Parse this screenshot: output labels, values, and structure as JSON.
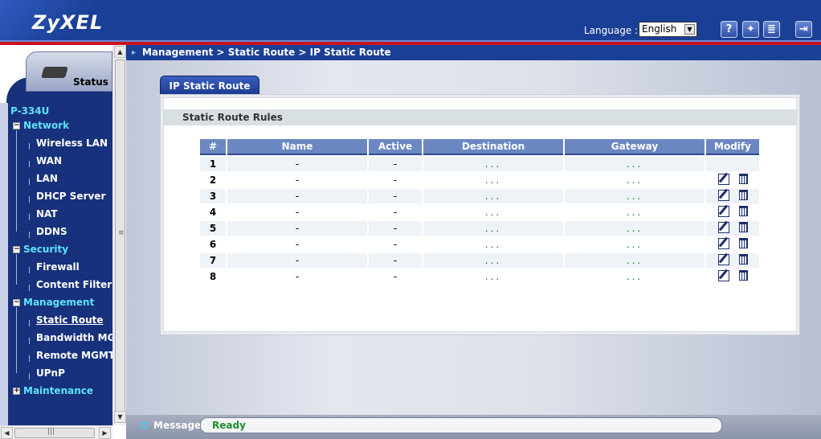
{
  "header": {
    "logo": "ZyXEL",
    "language_label": "Language :",
    "language_value": "English",
    "buttons": [
      {
        "name": "help-icon",
        "glyph": "?"
      },
      {
        "name": "wizard-icon",
        "glyph": "✦"
      },
      {
        "name": "notes-icon",
        "glyph": "≣"
      },
      {
        "name": "logout-icon",
        "glyph": "⇥"
      }
    ]
  },
  "sidebar": {
    "status_label": "Status",
    "model": "P-334U",
    "categories": [
      {
        "label": "Network",
        "expanded": true,
        "items": [
          "Wireless LAN",
          "WAN",
          "LAN",
          "DHCP Server",
          "NAT",
          "DDNS"
        ]
      },
      {
        "label": "Security",
        "expanded": true,
        "items": [
          "Firewall",
          "Content Filter"
        ]
      },
      {
        "label": "Management",
        "expanded": true,
        "items": [
          "Static Route",
          "Bandwidth MGMT",
          "Remote MGMT",
          "UPnP"
        ]
      },
      {
        "label": "Maintenance",
        "expanded": false,
        "items": []
      }
    ],
    "active_item": "Static Route"
  },
  "breadcrumb": "Management > Static Route > IP Static Route",
  "tab_label": "IP Static Route",
  "section_title": "Static Route Rules",
  "table": {
    "headers": [
      "#",
      "Name",
      "Active",
      "Destination",
      "Gateway",
      "Modify"
    ],
    "rows": [
      {
        "num": "1",
        "name": "-",
        "active": "-",
        "destination": "...",
        "gateway": "...",
        "modify": false
      },
      {
        "num": "2",
        "name": "-",
        "active": "-",
        "destination": "...",
        "gateway": "...",
        "modify": true
      },
      {
        "num": "3",
        "name": "-",
        "active": "-",
        "destination": "...",
        "gateway": "...",
        "modify": true
      },
      {
        "num": "4",
        "name": "-",
        "active": "-",
        "destination": "...",
        "gateway": "...",
        "modify": true
      },
      {
        "num": "5",
        "name": "-",
        "active": "-",
        "destination": "...",
        "gateway": "...",
        "modify": true
      },
      {
        "num": "6",
        "name": "-",
        "active": "-",
        "destination": "...",
        "gateway": "...",
        "modify": true
      },
      {
        "num": "7",
        "name": "-",
        "active": "-",
        "destination": "...",
        "gateway": "...",
        "modify": true
      },
      {
        "num": "8",
        "name": "-",
        "active": "-",
        "destination": "...",
        "gateway": "...",
        "modify": true
      }
    ]
  },
  "statusbar": {
    "label": "Message",
    "value": "Ready"
  },
  "colors": {
    "header_bg": "#1a3f96",
    "accent_red": "#c8141e",
    "nav_bg": "#17317c",
    "nav_category": "#5fe2ff",
    "table_header": "#6b87c2",
    "ready_text": "#1b8f2e"
  }
}
